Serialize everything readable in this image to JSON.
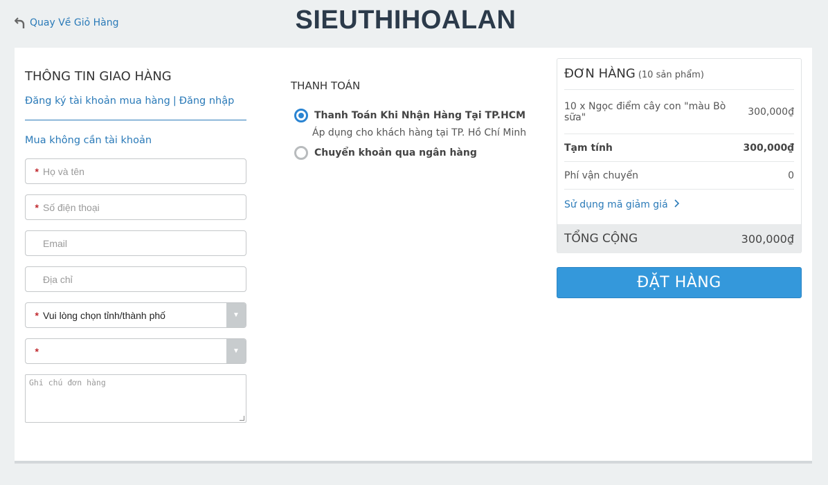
{
  "header": {
    "back_label": "Quay Về Giỏ Hàng",
    "logo": "SIEUTHIHOALAN"
  },
  "shipping": {
    "title": "THÔNG TIN GIAO HÀNG",
    "register_link": "Đăng ký tài khoản mua hàng",
    "separator": "|",
    "login_link": "Đăng nhập",
    "guest_label": "Mua không cần tài khoản",
    "required_mark": "*",
    "name_placeholder": "Họ và tên",
    "phone_placeholder": "Số điện thoại",
    "email_placeholder": "Email",
    "address_placeholder": "Địa chỉ",
    "province_selected": "Vui lòng chọn tỉnh/thành phố",
    "district_selected": "",
    "dropdown_arrow": "▼",
    "note_placeholder": "Ghi chú đơn hàng"
  },
  "payment": {
    "title": "THANH TOÁN",
    "option_cod": "Thanh Toán Khi Nhận Hàng Tại TP.HCM",
    "option_cod_desc": "Áp dụng cho khách hàng tại TP. Hồ Chí Minh",
    "option_bank": "Chuyển khoản qua ngân hàng"
  },
  "order": {
    "title": "ĐƠN HÀNG",
    "count": "(10 sản phẩm)",
    "item_name": "10 x Ngọc điểm cây con \"màu Bò sữa\"",
    "item_price": "300,000₫",
    "subtotal_label": "Tạm tính",
    "subtotal_value": "300,000₫",
    "shipping_label": "Phí vận chuyển",
    "shipping_value": "0",
    "coupon_label": "Sử dụng mã giảm giá",
    "total_label": "TỔNG CỘNG",
    "total_value": "300,000₫",
    "submit_label": "ĐẶT HÀNG"
  },
  "colors": {
    "accent": "#3498db",
    "link": "#2a7ab8",
    "required": "#c0282d"
  }
}
